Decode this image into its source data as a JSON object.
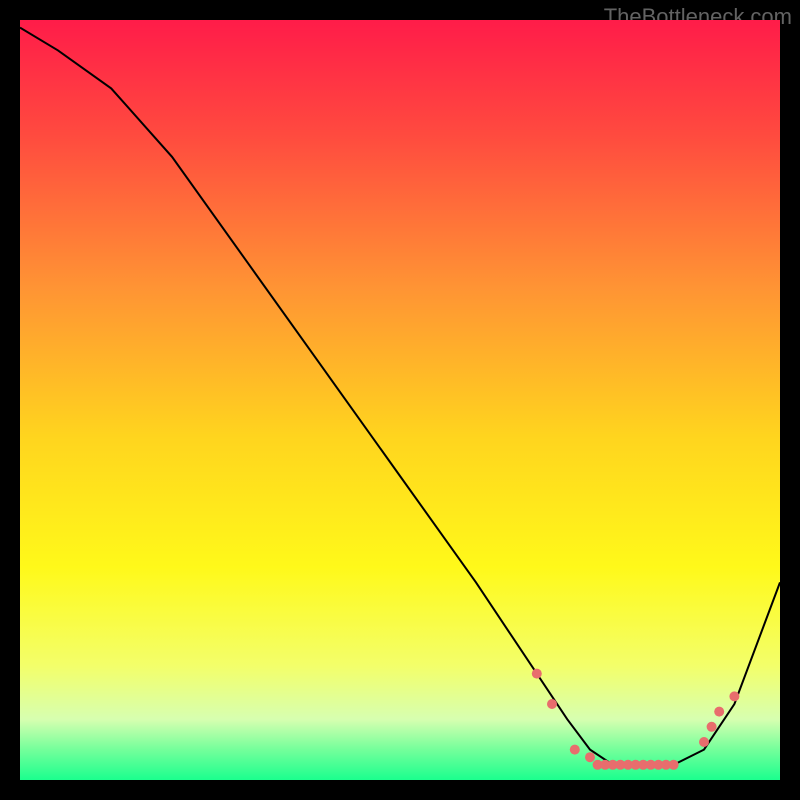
{
  "watermark": "TheBottleneck.com",
  "chart_data": {
    "type": "line",
    "title": "",
    "xlabel": "",
    "ylabel": "",
    "xlim": [
      0,
      100
    ],
    "ylim": [
      0,
      100
    ],
    "background_gradient": {
      "type": "vertical",
      "stops": [
        {
          "pos": 0.0,
          "color": "#ff1c49"
        },
        {
          "pos": 0.15,
          "color": "#ff4a3f"
        },
        {
          "pos": 0.35,
          "color": "#ff9334"
        },
        {
          "pos": 0.55,
          "color": "#ffd51e"
        },
        {
          "pos": 0.72,
          "color": "#fff91a"
        },
        {
          "pos": 0.85,
          "color": "#f3ff6a"
        },
        {
          "pos": 0.92,
          "color": "#d7ffb0"
        },
        {
          "pos": 0.96,
          "color": "#74ff9b"
        },
        {
          "pos": 1.0,
          "color": "#1bff8e"
        }
      ]
    },
    "series": [
      {
        "name": "bottleneck-curve",
        "color": "#000000",
        "x": [
          0,
          5,
          12,
          20,
          30,
          40,
          50,
          60,
          68,
          72,
          75,
          78,
          82,
          86,
          90,
          94,
          100
        ],
        "y": [
          99,
          96,
          91,
          82,
          68,
          54,
          40,
          26,
          14,
          8,
          4,
          2,
          2,
          2,
          4,
          10,
          26
        ]
      }
    ],
    "markers": {
      "name": "highlight-points",
      "color": "#e86d6d",
      "size": 5,
      "points": [
        {
          "x": 68,
          "y": 14
        },
        {
          "x": 70,
          "y": 10
        },
        {
          "x": 73,
          "y": 4
        },
        {
          "x": 75,
          "y": 3
        },
        {
          "x": 76,
          "y": 2
        },
        {
          "x": 77,
          "y": 2
        },
        {
          "x": 78,
          "y": 2
        },
        {
          "x": 79,
          "y": 2
        },
        {
          "x": 80,
          "y": 2
        },
        {
          "x": 81,
          "y": 2
        },
        {
          "x": 82,
          "y": 2
        },
        {
          "x": 83,
          "y": 2
        },
        {
          "x": 84,
          "y": 2
        },
        {
          "x": 85,
          "y": 2
        },
        {
          "x": 86,
          "y": 2
        },
        {
          "x": 90,
          "y": 5
        },
        {
          "x": 91,
          "y": 7
        },
        {
          "x": 92,
          "y": 9
        },
        {
          "x": 94,
          "y": 11
        }
      ]
    }
  }
}
